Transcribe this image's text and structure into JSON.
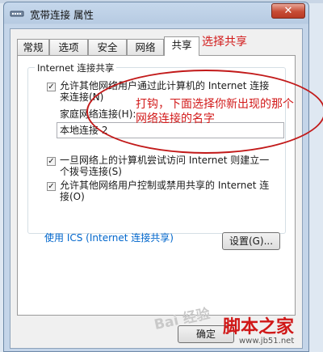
{
  "window": {
    "title": "宽带连接 属性",
    "close_glyph": "✕"
  },
  "tabs": [
    {
      "label": "常规"
    },
    {
      "label": "选项"
    },
    {
      "label": "安全"
    },
    {
      "label": "网络"
    },
    {
      "label": "共享"
    }
  ],
  "active_tab": "共享",
  "group": {
    "title": "Internet 连接共享",
    "allow_connect": {
      "checked": true,
      "line1": "允许其他网络用户通过此计算机的 Internet 连接",
      "line2": "来连接(N)"
    },
    "home_network": {
      "label": "家庭网络连接(H):",
      "value": "本地连接 2"
    },
    "dial_on_demand": {
      "checked": true,
      "line1": "一旦网络上的计算机尝试访问 Internet 则建立一",
      "line2": "个拨号连接(S)"
    },
    "allow_control": {
      "checked": true,
      "line1": "允许其他网络用户控制或禁用共享的 Internet 连",
      "line2": "接(O)"
    }
  },
  "ics_link": "使用 ICS (Internet 连接共享)",
  "settings_button": "设置(G)...",
  "ok_button": "确定",
  "annotations": {
    "select_share": "选择共享",
    "instruction_line1": "打钩，下面选择你新出现的那个",
    "instruction_line2": "网络连接的名字"
  },
  "watermark": "Bai 经验",
  "site": {
    "logo": "脚本之家",
    "url": "www.jb51.net"
  },
  "colors": {
    "annotation": "#d21a1a",
    "link": "#0066cc"
  }
}
